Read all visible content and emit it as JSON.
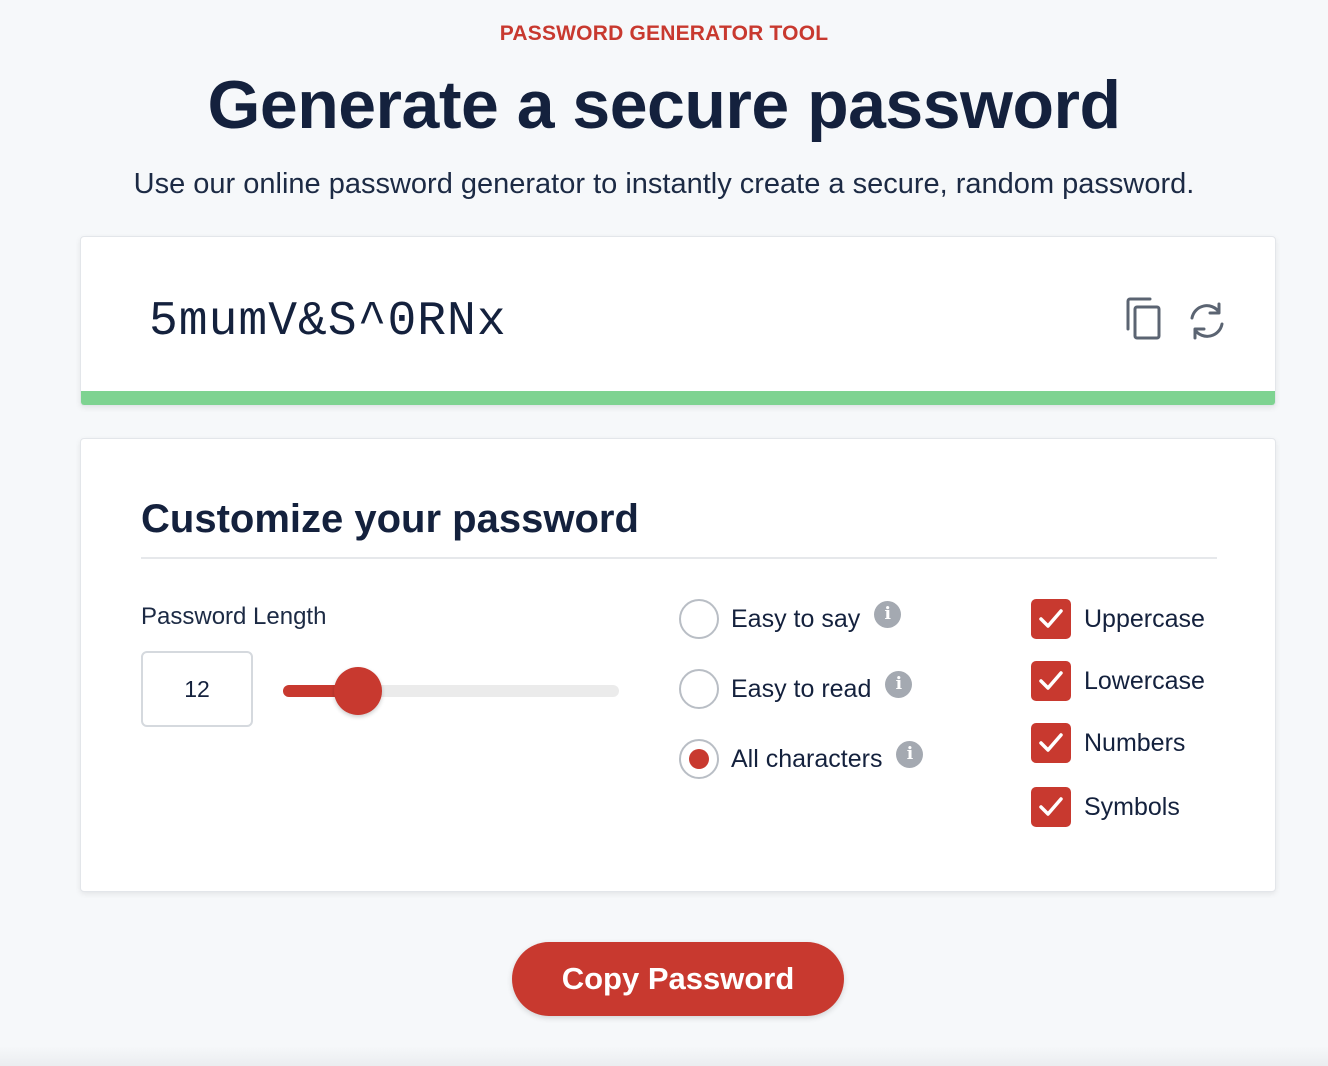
{
  "header": {
    "eyebrow": "PASSWORD GENERATOR TOOL",
    "title": "Generate a secure password",
    "subtitle": "Use our online password generator to instantly create a secure, random password."
  },
  "password": {
    "value": "5mumV&S^0RNx",
    "copy_icon": "copy-icon",
    "refresh_icon": "refresh-icon",
    "strength_percent": 100,
    "strength_color": "#7ed391"
  },
  "customize": {
    "title": "Customize your password",
    "length_label": "Password Length",
    "length_value": "12",
    "slider": {
      "min": 1,
      "max": 50,
      "value": 12
    },
    "modes": [
      {
        "label": "Easy to say",
        "selected": false
      },
      {
        "label": "Easy to read",
        "selected": false
      },
      {
        "label": "All characters",
        "selected": true
      }
    ],
    "char_types": [
      {
        "label": "Uppercase",
        "checked": true
      },
      {
        "label": "Lowercase",
        "checked": true
      },
      {
        "label": "Numbers",
        "checked": true
      },
      {
        "label": "Symbols",
        "checked": true
      }
    ]
  },
  "copy_button": "Copy Password",
  "colors": {
    "accent": "#c8392f",
    "navy": "#14213d",
    "strength": "#7ed391",
    "background": "#f6f8fa"
  }
}
